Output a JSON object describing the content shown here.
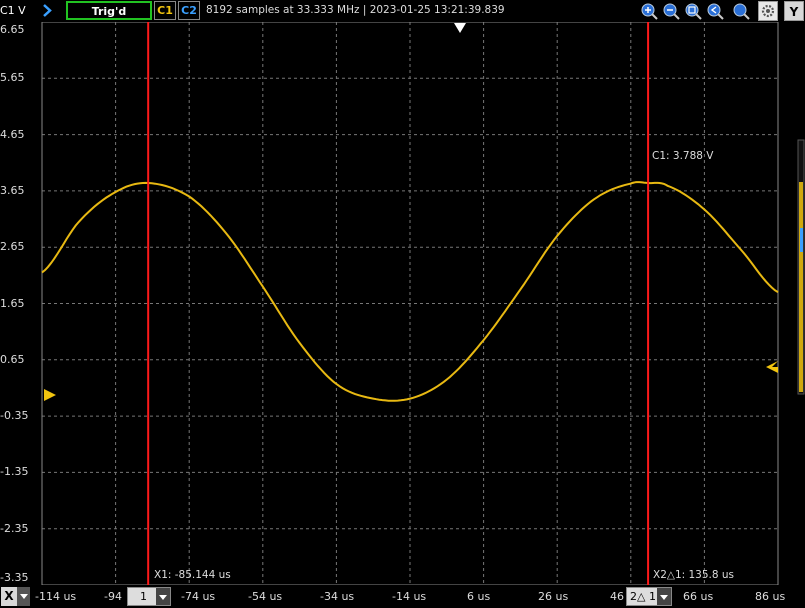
{
  "toolbar": {
    "channel_unit": "C1 V",
    "trigger_status": "Trig'd",
    "channel1_label": "C1",
    "channel2_label": "C2",
    "acquisition_info": "8192 samples at 33.333 MHz | 2023-01-25 13:21:39.839",
    "y_button": "Y"
  },
  "colors": {
    "trace": "#e8b912",
    "cursor": "#ff1a1a",
    "grid": "#777777",
    "trigger_border": "#22c322",
    "channel1": "#f1c40f",
    "channel2": "#3aa0ff"
  },
  "y_axis": {
    "tick_labels": [
      "6.65",
      "5.65",
      "4.65",
      "3.65",
      "2.65",
      "1.65",
      "0.65",
      "-0.35",
      "-1.35",
      "-2.35",
      "-3.35"
    ]
  },
  "x_axis": {
    "tick_labels": [
      "-114 us",
      "-94",
      "-74 us",
      "-54 us",
      "-34 us",
      "-14 us",
      "6 us",
      "26 us",
      "46",
      "66 us",
      "86 us"
    ],
    "x_button": "X"
  },
  "cursors": {
    "x1_readout": "X1: -85.144 us",
    "x2_readout": "X2△1: 135.8 us",
    "c1_readout": "C1: 3.788 V",
    "x1_selector": "1",
    "x2_selector": "2△ 1"
  },
  "chart_data": {
    "type": "line",
    "xlabel": "",
    "ylabel": "C1 V",
    "ylim": [
      -3.35,
      6.65
    ],
    "xlim": [
      -114,
      86
    ],
    "series": [
      {
        "x": [
          -114,
          -104,
          -94,
          -85.1,
          -74,
          -64,
          -54,
          -44,
          -34,
          -24,
          -14,
          -4,
          6,
          16,
          26,
          36,
          46,
          50.7,
          56,
          66,
          76,
          86
        ],
        "y": [
          2.2,
          3.1,
          3.63,
          3.79,
          3.55,
          2.9,
          1.95,
          0.95,
          0.22,
          -0.04,
          -0.04,
          0.3,
          1.0,
          1.9,
          2.85,
          3.5,
          3.78,
          3.79,
          3.74,
          3.32,
          2.6,
          1.85
        ]
      }
    ],
    "cursors": {
      "x1": -85.144,
      "x2": 50.7,
      "c1_value": 3.788
    },
    "grid": true
  }
}
